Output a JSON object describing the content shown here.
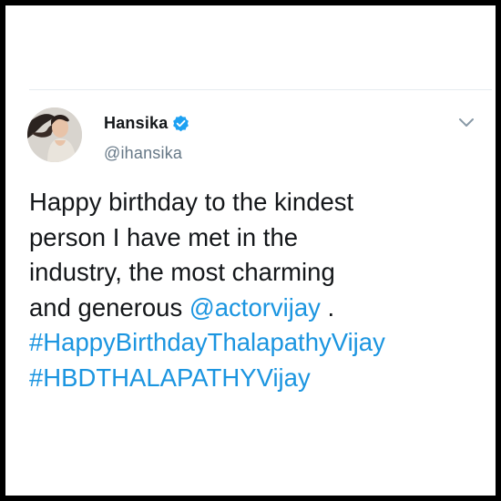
{
  "tweet": {
    "author": {
      "display_name": "Hansika",
      "handle": "@ihansika",
      "verified": true,
      "avatar_icon": "profile-photo"
    },
    "menu_icon": "chevron-down-icon",
    "text_lines": [
      {
        "text": "Happy birthday to the kindest"
      },
      {
        "text": "person I have met in the"
      },
      {
        "text": "industry, the most charming"
      },
      {
        "text_before": "and generous ",
        "mention": "@actorvijay",
        "text_after": " ."
      },
      {
        "hashtag": "#HappyBirthdayThalapathyVijay"
      },
      {
        "hashtag": "#HBDTHALAPATHYVijay"
      }
    ]
  },
  "colors": {
    "link": "#1b95e0",
    "text": "#14171a",
    "secondary": "#657786",
    "verified_badge": "#1da1f2",
    "frame_border": "#000000"
  }
}
